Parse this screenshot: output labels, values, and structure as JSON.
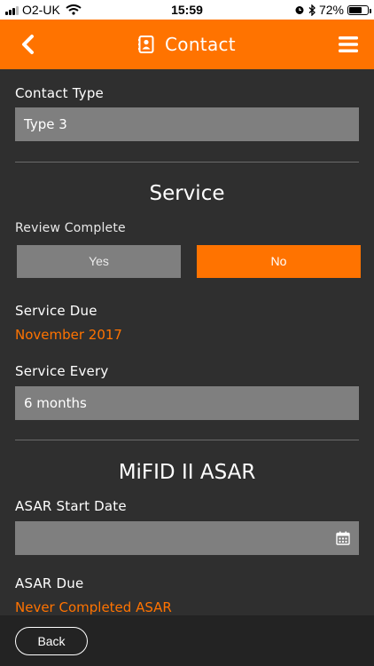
{
  "status_bar": {
    "carrier": "O2-UK",
    "time": "15:59",
    "battery_percent": "72%",
    "battery_level": 0.72,
    "icons": [
      "signal-icon",
      "wifi-icon",
      "alarm-icon",
      "bluetooth-icon",
      "battery-icon"
    ]
  },
  "header": {
    "title": "Contact",
    "accent_color": "#ff7300",
    "icons": [
      "back-chevron-icon",
      "contact-card-icon",
      "hamburger-menu-icon"
    ]
  },
  "contact": {
    "type_label": "Contact Type",
    "type_value": "Type 3"
  },
  "service": {
    "title": "Service",
    "review_label": "Review Complete",
    "yes_label": "Yes",
    "no_label": "No",
    "selected": "No",
    "due_label": "Service Due",
    "due_value": "November 2017",
    "every_label": "Service Every",
    "every_value": "6 months"
  },
  "asar": {
    "title": "MiFID II ASAR",
    "start_label": "ASAR Start Date",
    "start_value": "",
    "due_label": "ASAR Due",
    "due_value": "Never Completed ASAR"
  },
  "footer": {
    "back_label": "Back"
  }
}
